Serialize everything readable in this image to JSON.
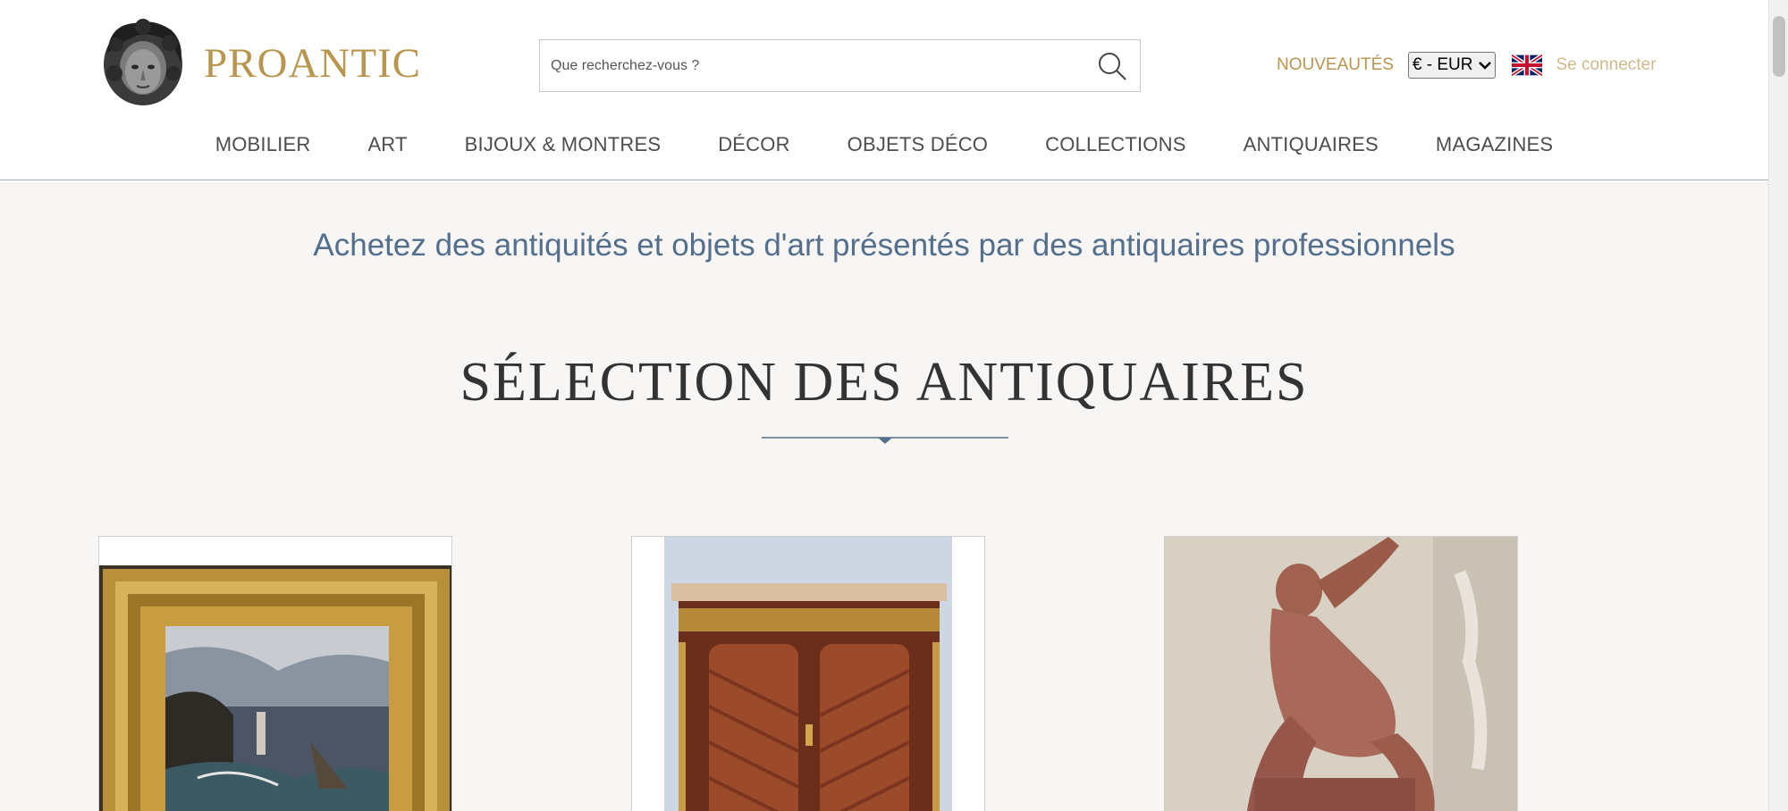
{
  "header": {
    "logo_text": "PROANTIC",
    "search_placeholder": "Que recherchez-vous ?",
    "nouveautes": "NOUVEAUTÉS",
    "currency_selected": "€ - EUR",
    "login": "Se connecter"
  },
  "nav": {
    "items": [
      "MOBILIER",
      "ART",
      "BIJOUX & MONTRES",
      "DÉCOR",
      "OBJETS DÉCO",
      "COLLECTIONS",
      "ANTIQUAIRES",
      "MAGAZINES"
    ]
  },
  "main": {
    "tagline": "Achetez des antiquités et objets d'art présentés par des antiquaires professionnels",
    "section_title": "SÉLECTION DES ANTIQUAIRES"
  },
  "colors": {
    "brand_gold": "#b8964f",
    "accent_blue": "#536f8b",
    "background": "#f7f6f4"
  },
  "icons": [
    "logo-head-icon",
    "search-icon",
    "uk-flag-icon",
    "chevron-down-icon"
  ]
}
